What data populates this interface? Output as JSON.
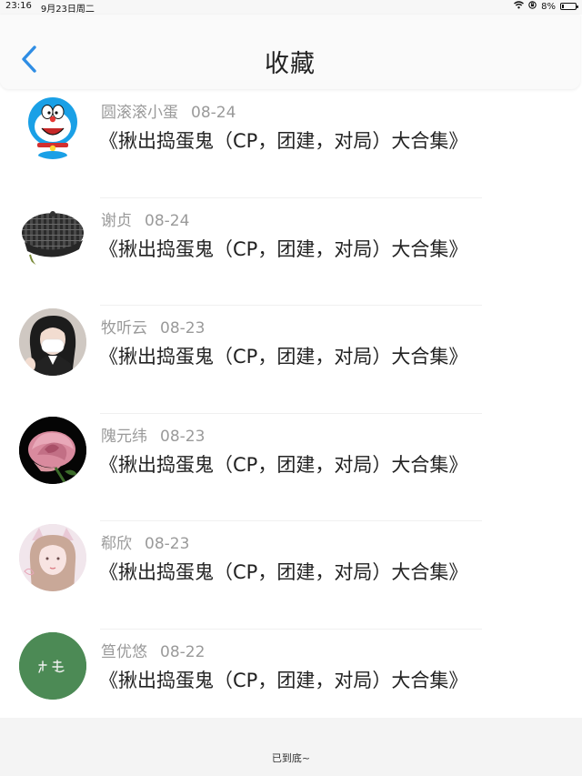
{
  "status_bar": {
    "time": "23:16",
    "date": "9月23日周二",
    "battery": "8%",
    "battery_level": 0.08
  },
  "header": {
    "title": "收藏",
    "back_icon": "chevron-left-icon",
    "accent_color": "#2f8de4"
  },
  "items": [
    {
      "author": "圆滚滚小蛋",
      "date": "08-24",
      "title": "《揪出捣蛋鬼（CP，团建，对局）大合集》",
      "avatar": "doraemon"
    },
    {
      "author": "谢贞",
      "date": "08-24",
      "title": "《揪出捣蛋鬼（CP，团建，对局）大合集》",
      "avatar": "plaid-beret"
    },
    {
      "author": "牧听云",
      "date": "08-23",
      "title": "《揪出捣蛋鬼（CP，团建，对局）大合集》",
      "avatar": "girl-with-mask"
    },
    {
      "author": "隗元纬",
      "date": "08-23",
      "title": "《揪出捣蛋鬼（CP，团建，对局）大合集》",
      "avatar": "pink-rose"
    },
    {
      "author": "郗欣",
      "date": "08-23",
      "title": "《揪出捣蛋鬼（CP，团建，对局）大合集》",
      "avatar": "cat-ear-girl"
    },
    {
      "author": "笪优悠",
      "date": "08-22",
      "title": "《揪出捣蛋鬼（CP，团建，对局）大合集》",
      "avatar": "green-calligraphy"
    }
  ],
  "footer": {
    "end_text": "已到底~"
  }
}
